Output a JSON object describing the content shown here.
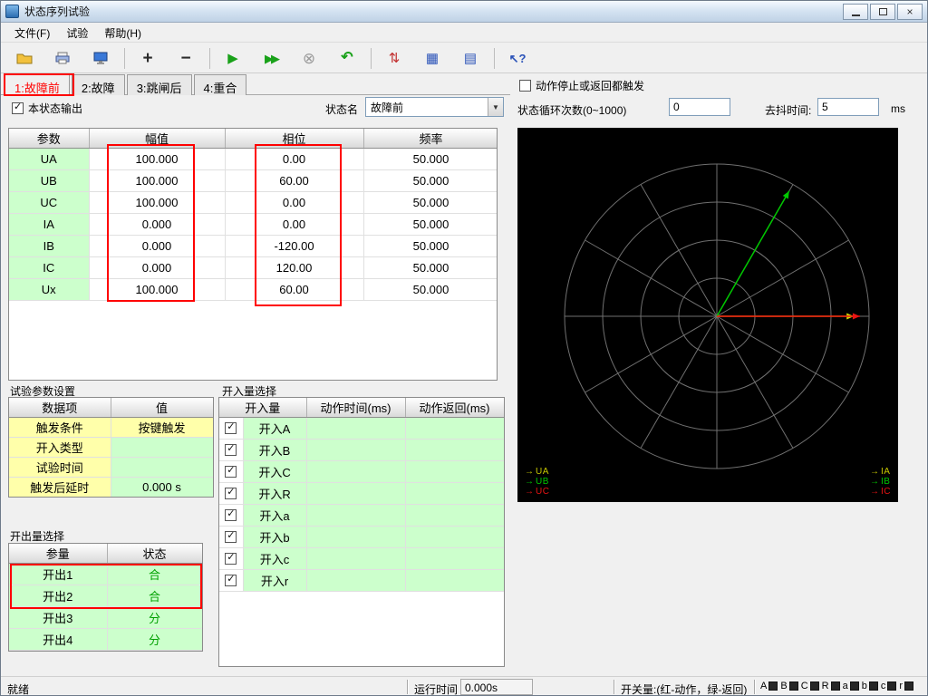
{
  "window": {
    "title": "状态序列试验"
  },
  "menu": {
    "items": [
      "文件(F)",
      "试验",
      "帮助(H)"
    ]
  },
  "toolbar_icons": {
    "plus": "+",
    "minus": "−",
    "play": "▶",
    "fast_forward": "▶▶",
    "stop": "⊗",
    "undo": "↶",
    "adjust": "⇅",
    "grid": "▦",
    "calculator": "▤",
    "help": "↖?"
  },
  "tabs": [
    {
      "label": "1:故障前"
    },
    {
      "label": "2:故障"
    },
    {
      "label": "3:跳闸后"
    },
    {
      "label": "4:重合"
    }
  ],
  "state_controls": {
    "output_checkbox_label": "本状态输出",
    "state_name_label": "状态名",
    "state_name_value": "故障前",
    "trigger_checkbox_label": "动作停止或返回都触发",
    "cycle_label": "状态循环次数(0~1000)",
    "cycle_value": "0",
    "debounce_label": "去抖时间:",
    "debounce_value": "5",
    "debounce_unit": "ms"
  },
  "param_table": {
    "headers": [
      "参数",
      "幅值",
      "相位",
      "频率"
    ],
    "rows": [
      [
        "UA",
        "100.000",
        "0.00",
        "50.000"
      ],
      [
        "UB",
        "100.000",
        "60.00",
        "50.000"
      ],
      [
        "UC",
        "100.000",
        "0.00",
        "50.000"
      ],
      [
        "IA",
        "0.000",
        "0.00",
        "50.000"
      ],
      [
        "IB",
        "0.000",
        "-120.00",
        "50.000"
      ],
      [
        "IC",
        "0.000",
        "120.00",
        "50.000"
      ],
      [
        "Ux",
        "100.000",
        "60.00",
        "50.000"
      ]
    ]
  },
  "test_params": {
    "title": "试验参数设置",
    "headers": [
      "数据项",
      "值"
    ],
    "rows": [
      [
        "触发条件",
        "按键触发"
      ],
      [
        "开入类型",
        ""
      ],
      [
        "试验时间",
        ""
      ],
      [
        "触发后延时",
        "0.000 s"
      ]
    ]
  },
  "output_select": {
    "title": "开出量选择",
    "headers": [
      "参量",
      "状态"
    ],
    "rows": [
      [
        "开出1",
        "合"
      ],
      [
        "开出2",
        "合"
      ],
      [
        "开出3",
        "分"
      ],
      [
        "开出4",
        "分"
      ]
    ]
  },
  "input_select": {
    "title": "开入量选择",
    "headers": [
      "开入量",
      "动作时间(ms)",
      "动作返回(ms)"
    ],
    "rows": [
      [
        "开入A",
        "",
        ""
      ],
      [
        "开入B",
        "",
        ""
      ],
      [
        "开入C",
        "",
        ""
      ],
      [
        "开入R",
        "",
        ""
      ],
      [
        "开入a",
        "",
        ""
      ],
      [
        "开入b",
        "",
        ""
      ],
      [
        "开入c",
        "",
        ""
      ],
      [
        "开入r",
        "",
        ""
      ]
    ]
  },
  "phasor": {
    "background": "#000000",
    "grid_color": "#707070",
    "circles": 4,
    "spokes": 12,
    "arrows": [
      {
        "name": "UA",
        "color": "#d6d600",
        "angle_deg": 0,
        "magnitude": 0.9
      },
      {
        "name": "UB",
        "color": "#00c800",
        "angle_deg": 60,
        "magnitude": 0.95
      },
      {
        "name": "UC",
        "color": "#e81313",
        "angle_deg": 0,
        "magnitude": 0.94
      }
    ],
    "legend_left": [
      {
        "label": "UA",
        "color": "#c8c800"
      },
      {
        "label": "UB",
        "color": "#00c800"
      },
      {
        "label": "UC",
        "color": "#e81313"
      }
    ],
    "legend_right": [
      {
        "label": "IA",
        "color": "#c8c800"
      },
      {
        "label": "IB",
        "color": "#00c800"
      },
      {
        "label": "IC",
        "color": "#e81313"
      }
    ]
  },
  "status_bar": {
    "ready": "就绪",
    "runtime_label": "运行时间",
    "runtime_value": "0.000s",
    "switch_hint": "开关量:(红-动作，绿-返回)",
    "switches": [
      "A",
      "B",
      "C",
      "R",
      "a",
      "b",
      "c",
      "r"
    ]
  },
  "annotations": {
    "color": "#ff0000",
    "items": [
      "active-tab",
      "amplitude-column",
      "phase-column",
      "output-rows-1-2"
    ]
  }
}
